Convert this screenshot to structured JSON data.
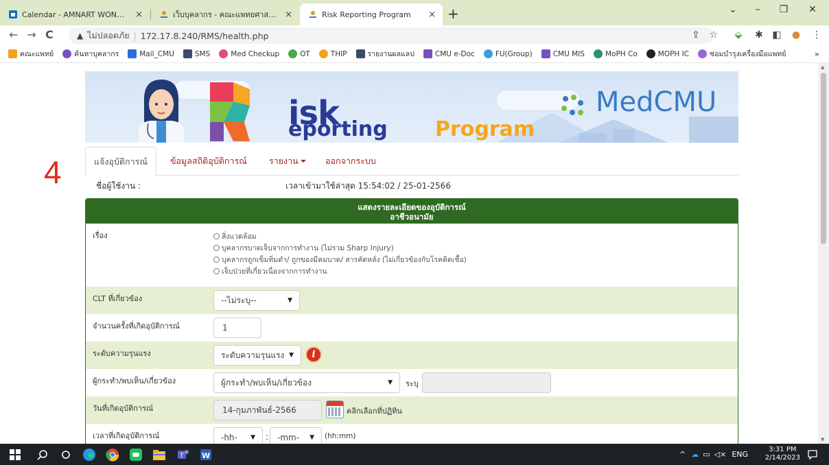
{
  "browser": {
    "tabs": [
      {
        "title": "Calendar - AMNART WONGCHAI",
        "favicon": "calendar-icon",
        "active": false
      },
      {
        "title": "เว็บบุคลากร - คณะแพทยศาสตร์ มหาวิทยาลัย",
        "favicon": "site-icon",
        "active": false
      },
      {
        "title": "Risk Reporting Program",
        "favicon": "site-icon",
        "active": true
      }
    ],
    "close_glyph": "×",
    "new_tab_glyph": "+",
    "window_controls": {
      "dropdown": "⌄",
      "minimize": "–",
      "restore": "❐",
      "close": "✕"
    },
    "nav": {
      "back": "←",
      "forward": "→",
      "reload": "C"
    },
    "address": {
      "security_icon": "warning-icon",
      "security_glyph": "▲",
      "security_text": "ไม่ปลอดภัย",
      "separator": "|",
      "url": "172.17.8.240/RMS/health.php"
    },
    "toolbar_icons": [
      {
        "name": "share-icon",
        "glyph": "⇪"
      },
      {
        "name": "star-icon",
        "glyph": "☆"
      },
      {
        "name": "extension-icon",
        "glyph": "⬙"
      },
      {
        "name": "puzzle-icon",
        "glyph": "✱"
      },
      {
        "name": "sidepanel-icon",
        "glyph": "◧"
      },
      {
        "name": "profile-icon",
        "glyph": "●"
      },
      {
        "name": "menu-icon",
        "glyph": "⋮"
      }
    ],
    "bookmarks": [
      {
        "label": "คณะแพทย์",
        "color": "#f0a31b"
      },
      {
        "label": "ค้นหาบุคลากร",
        "color": "#7a4fc2"
      },
      {
        "label": "Mail_CMU",
        "color": "#2b6fd6"
      },
      {
        "label": "SMS",
        "color": "#3a4c6a"
      },
      {
        "label": "Med Checkup",
        "color": "#e24c73"
      },
      {
        "label": "OT",
        "color": "#4aa84a"
      },
      {
        "label": "THIP",
        "color": "#f0a31b"
      },
      {
        "label": "รายงานผลแลป",
        "color": "#3a4c6a"
      },
      {
        "label": "CMU e-Doc",
        "color": "#7a4fc2"
      },
      {
        "label": "FU(Group)",
        "color": "#3aa0d8"
      },
      {
        "label": "CMU MIS",
        "color": "#7a4fc2"
      },
      {
        "label": "MoPH Co",
        "color": "#2c8f6e"
      },
      {
        "label": "MOPH IC",
        "color": "#222222"
      },
      {
        "label": "ซ่อมบำรุงเครื่องมือแพทย์",
        "color": "#9a67d8"
      }
    ],
    "bookmarks_more": "»"
  },
  "banner": {
    "risk": "isk",
    "eporting": "eporting",
    "program": "Program",
    "brand": "MedCMU"
  },
  "annotation": "4",
  "nav_tabs": [
    {
      "label": "แจ้งอุบัติการณ์",
      "active": true
    },
    {
      "label": "ข้อมูลสถิติอุบัติการณ์",
      "active": false
    },
    {
      "label": "รายงาน",
      "active": false,
      "dropdown": true
    },
    {
      "label": "ออกจากระบบ",
      "active": false
    }
  ],
  "user_label": "ชื่อผู้ใช้งาน :",
  "last_login": "เวลาเข้ามาใช้ล่าสุด 15:54:02 / 25-01-2566",
  "form": {
    "header_line1": "แสดงรายละเอียดของอุบัติการณ์",
    "header_line2": "อาชีวอนามัย",
    "rows": [
      {
        "label": "เรื่อง",
        "radios": [
          "สิ่งแวดล้อม",
          "บุคลากรบาดเจ็บจากการทำงาน (ไม่รวม Sharp Injury)",
          "บุคลากรถูกเข็มทิ่มตำ/ ถูกของมีคมบาด/ สารคัดหลั่ง (ไม่เกี่ยวข้องกับโรคติดเชื้อ)",
          "เจ็บป่วยที่เกี่ยวเนื่องจากการทำงาน"
        ]
      },
      {
        "label": "CLT ที่เกี่ยวข้อง",
        "select": "--ไม่ระบุ--"
      },
      {
        "label": "จำนวนครั้งที่เกิดอุบัติการณ์",
        "value": "1"
      },
      {
        "label": "ระดับความรุนแรง",
        "select": "ระดับความรุนแรง",
        "info_glyph": "i"
      },
      {
        "label": "ผู้กระทำ/พบเห็น/เกี่ยวข้อง",
        "select": "ผู้กระทำ/พบเห็น/เกี่ยวข้อง",
        "specify_label": "ระบุ",
        "specify_value": ""
      },
      {
        "label": "วันที่เกิดอุบัติการณ์",
        "value": "14-กุมภาพันธ์-2566",
        "calendar_hint": "คลิกเลือกที่ปฏิทิน"
      },
      {
        "label": "เวลาที่เกิดอุบัติการณ์",
        "hh": "-hh-",
        "mm": "-mm-",
        "sep": ":",
        "format": "(hh:mm)"
      }
    ]
  },
  "taskbar": {
    "tray_lang": "ENG",
    "time": "3:31 PM",
    "date": "2/14/2023"
  }
}
